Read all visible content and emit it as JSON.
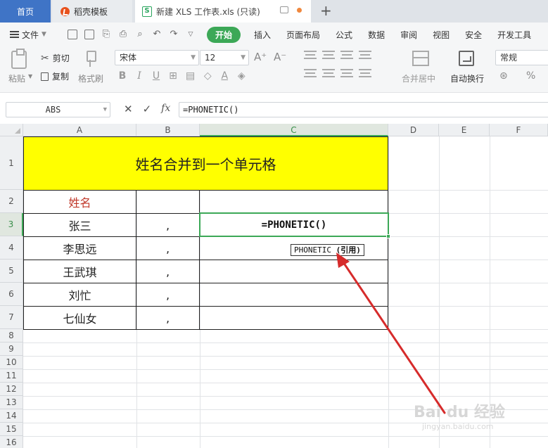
{
  "tabs": {
    "home": "首页",
    "template": "稻壳模板",
    "document": "新建 XLS 工作表.xls (只读)"
  },
  "menu": {
    "file": "文件",
    "items": [
      "开始",
      "插入",
      "页面布局",
      "公式",
      "数据",
      "审阅",
      "视图",
      "安全",
      "开发工具"
    ]
  },
  "ribbon": {
    "paste": "粘贴",
    "cut": "剪切",
    "copy": "复制",
    "format_painter": "格式刷",
    "font_name": "宋体",
    "font_size": "12",
    "merge": "合并居中",
    "wrap": "自动换行",
    "number_format": "常规"
  },
  "formula_bar": {
    "name_box": "ABS",
    "cancel": "✕",
    "confirm": "✓",
    "fx": "fx",
    "formula": "=PHONETIC()"
  },
  "sheet": {
    "columns": [
      "A",
      "B",
      "C",
      "D",
      "E",
      "F"
    ],
    "rows": [
      "1",
      "2",
      "3",
      "4",
      "5",
      "6",
      "7",
      "8",
      "9",
      "10",
      "11",
      "12",
      "13",
      "14",
      "15",
      "16"
    ],
    "title": "姓名合并到一个单元格",
    "header_name": "姓名",
    "names": [
      "张三",
      "李思远",
      "王武琪",
      "刘忙",
      "七仙女"
    ],
    "separator": ",",
    "active_cell_formula": "=PHONETIC()",
    "tooltip_func": "PHONETIC",
    "tooltip_arg": "(引用)"
  },
  "watermark": {
    "brand": "Bai du 经验",
    "url": "jingyan.baidu.com"
  },
  "colors": {
    "accent": "#3ca857",
    "title_fill": "#ffff00",
    "arrow": "#d62b2b",
    "header_text": "#c0392b"
  }
}
